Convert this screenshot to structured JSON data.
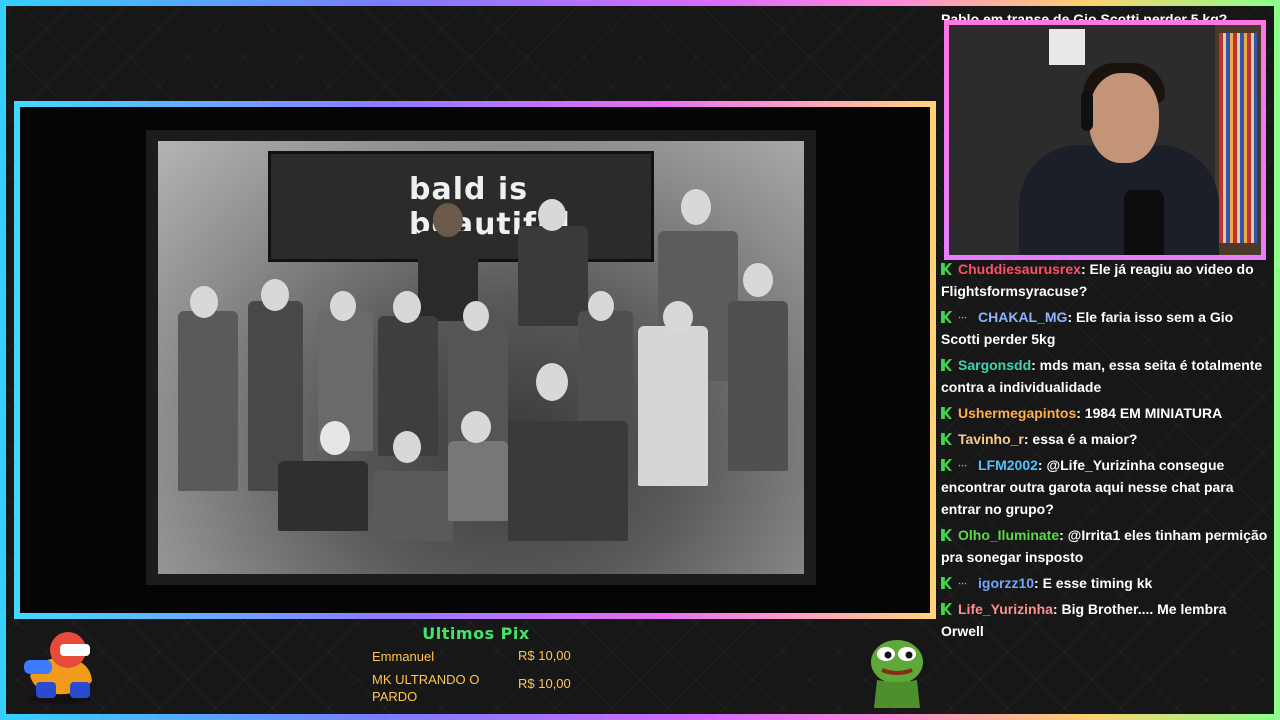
{
  "top_message": "Pablo em transe de Gio Scotti perder 5 kg?",
  "photo": {
    "banner_text": "bald is beautiful"
  },
  "chat": {
    "messages": [
      {
        "user": "Chuddiesaurusrex",
        "color": "#ff4f6a",
        "text": ": Ele já reagiu ao video do Flightsformsyracuse?",
        "sub": false
      },
      {
        "user": "CHAKAL_MG",
        "color": "#8ab4ff",
        "text": ": Ele faria isso sem a Gio Scotti perder 5kg",
        "sub": true
      },
      {
        "user": "Sargonsdd",
        "color": "#3ad6b0",
        "text": ": mds man, essa seita é totalmente contra a individualidade",
        "sub": false
      },
      {
        "user": "Ushermegapintos",
        "color": "#ffb04a",
        "text": ": 1984 EM MINIATURA",
        "sub": false
      },
      {
        "user": "Tavinho_r",
        "color": "#ffc98a",
        "text": ": essa é a maior?",
        "sub": false
      },
      {
        "user": "LFM2002",
        "color": "#4fc3ff",
        "text": ": @Life_Yurizinha consegue encontrar outra garota aqui nesse chat para entrar no grupo?",
        "sub": true
      },
      {
        "user": "Olho_Iluminate",
        "color": "#5fd84a",
        "text": ": @Irrita1 eles tinham permição pra sonegar insposto",
        "sub": false
      },
      {
        "user": "igorzz10",
        "color": "#6fa8ff",
        "text": ": E esse timing kk",
        "sub": true
      },
      {
        "user": "Life_Yurizinha",
        "color": "#ff8e8e",
        "text": ": Big Brother.... Me lembra Orwell",
        "sub": false
      }
    ]
  },
  "pix": {
    "title": "Ultimos Pix",
    "rows": [
      {
        "name": "Emmanuel",
        "amount": "R$ 10,00"
      },
      {
        "name": "MK ULTRANDO O PARDO",
        "amount": "R$ 10,00"
      }
    ]
  },
  "colors": {
    "badge_green": "#3dd64b",
    "pix_title": "#45e36a",
    "pix_text": "#ffc54d"
  },
  "icons": {
    "chat_badge": "kick-badge-icon",
    "left_mascot": "mascot-sticker-icon",
    "right_mascot": "pepe-frog-icon"
  }
}
